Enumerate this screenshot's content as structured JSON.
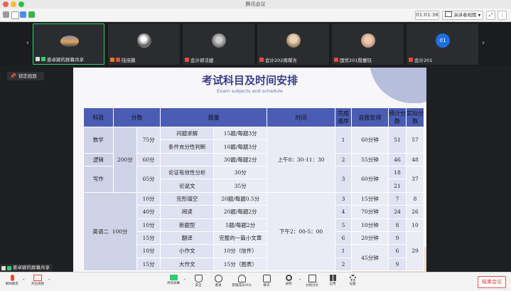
{
  "window": {
    "title": "腾讯会议"
  },
  "toolbar": {
    "timer": "01:01:38",
    "view_label": "演讲者视图"
  },
  "participants": [
    {
      "name": "姜卓颖的屏幕共享",
      "active": true
    },
    {
      "name": "陆佳鹏",
      "active": false
    },
    {
      "name": "会计郭法媛",
      "active": false
    },
    {
      "name": "会计202周璨含",
      "active": false
    },
    {
      "name": "国贸201殷蕾钰",
      "active": false
    },
    {
      "name": "会计201",
      "active": false,
      "avatar_text": "01"
    }
  ],
  "lock_button": "锁定画面",
  "slide": {
    "title": "考试科目及时间安排",
    "subtitle": "Exam subjects and schedule",
    "headers": [
      "科目",
      "分数",
      "题量",
      "时间",
      "完成顺序",
      "自我安排",
      "预计分数",
      "实际分数"
    ],
    "math": {
      "subject": "数学",
      "q1": "问题求解",
      "q1_count": "15题/每题3分",
      "q2": "条件充分性判断",
      "q2_count": "10题/每题3分",
      "score": "75分",
      "order": "1",
      "plan": "60分钟",
      "expected": "51",
      "actual": "57"
    },
    "logic": {
      "subject": "逻辑",
      "score": "60分",
      "count": "30题/每题2分",
      "order": "2",
      "plan": "55分钟",
      "expected": "46",
      "actual": "48"
    },
    "section1_total": "200分",
    "morning_time": "上午8：30-11：30",
    "writing": {
      "subject": "写作",
      "score": "65分",
      "q1": "论证有效性分析",
      "q1_score": "30分",
      "q2": "论说文",
      "q2_score": "35分",
      "order": "3",
      "plan": "60分钟",
      "expected1": "18",
      "expected2": "21",
      "actual": "37"
    },
    "english": {
      "subject": "英语二",
      "total": "100分",
      "afternoon_time": "下午2：00-5：00",
      "rows": [
        {
          "score": "10分",
          "item": "完形填空",
          "count": "20题/每题0.5分",
          "order": "3",
          "plan": "15分钟",
          "expected": "7",
          "actual": "8"
        },
        {
          "score": "40分",
          "item": "阅读",
          "count": "20题/每题2分",
          "order": "4",
          "plan": "70分钟",
          "expected": "24",
          "actual": "26"
        },
        {
          "score": "10分",
          "item": "新题型",
          "count": "5题/每题2分",
          "order": "5",
          "plan": "10分钟",
          "expected": "8",
          "actual": "10"
        },
        {
          "score": "15分",
          "item": "翻译",
          "count": "完整的一篇小文章",
          "order": "6",
          "plan": "20分钟",
          "expected": "9",
          "actual": ""
        },
        {
          "score": "10分",
          "item": "小作文",
          "count": "10分（信件）",
          "order": "1",
          "plan": "45分钟",
          "expected": "6",
          "actual": "29"
        },
        {
          "score": "15分",
          "item": "大作文",
          "count": "15分（图表）",
          "order": "2",
          "plan": "",
          "expected": "9",
          "actual": ""
        }
      ]
    }
  },
  "share_label": "姜卓颖的屏幕共享",
  "bottombar": {
    "mute": "解除静音",
    "video": "开启视频",
    "share": "共享屏幕",
    "security": "安全",
    "invite": "邀请",
    "members": "管理成员(93)",
    "chat": "聊天",
    "record": "录制",
    "breakout": "分组讨论",
    "apps": "应用",
    "settings": "设置",
    "end": "结束会议"
  },
  "colors": {
    "accent_green": "#2ecc71",
    "header_blue": "#4a5cb3",
    "end_red": "#d23c3c"
  }
}
